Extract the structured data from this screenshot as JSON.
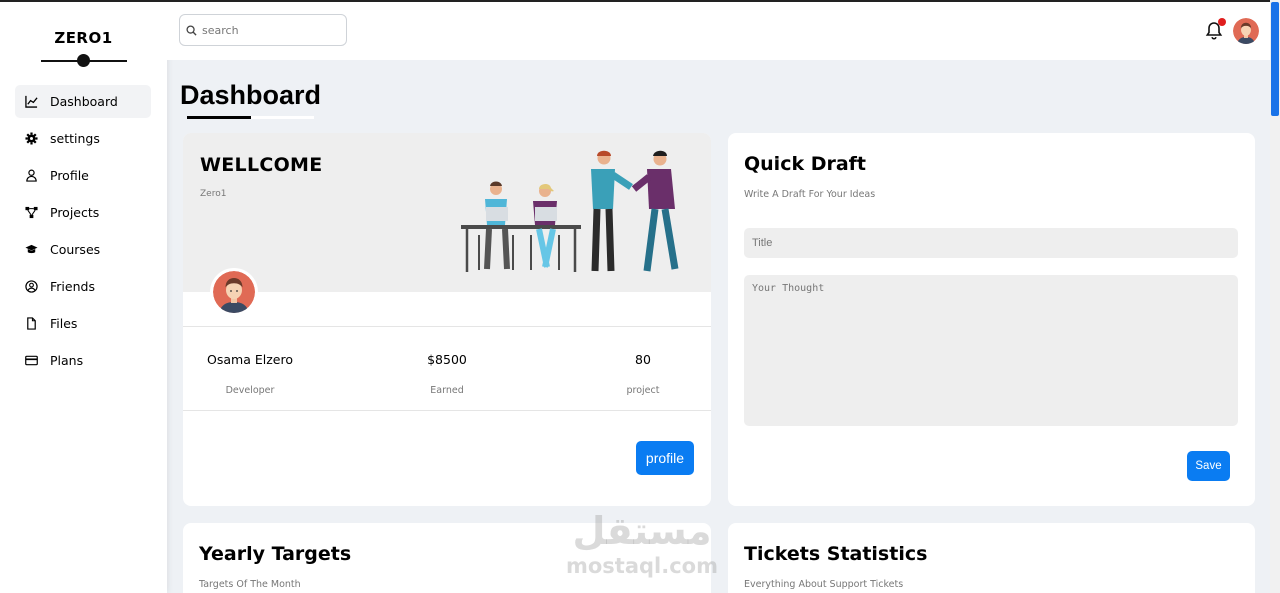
{
  "sidebar": {
    "brand": "ZERO1",
    "items": [
      {
        "label": "Dashboard",
        "icon": "chart-line-icon",
        "active": true
      },
      {
        "label": "settings",
        "icon": "gear-icon"
      },
      {
        "label": "Profile",
        "icon": "user-icon"
      },
      {
        "label": "Projects",
        "icon": "diagram-icon"
      },
      {
        "label": "Courses",
        "icon": "graduation-cap-icon"
      },
      {
        "label": "Friends",
        "icon": "user-circle-icon"
      },
      {
        "label": "Files",
        "icon": "file-icon"
      },
      {
        "label": "Plans",
        "icon": "credit-card-icon"
      }
    ]
  },
  "header": {
    "search_placeholder": "search",
    "notification_badge_color": "#e01e1e"
  },
  "page": {
    "title": "Dashboard"
  },
  "welcome": {
    "heading": "WELLCOME",
    "subheading": "Zero1",
    "stats": [
      {
        "value": "Osama Elzero",
        "label": "Developer"
      },
      {
        "value": "$8500",
        "label": "Earned"
      },
      {
        "value": "80",
        "label": "project"
      }
    ],
    "button": "profile"
  },
  "draft": {
    "heading": "Quick Draft",
    "subheading": "Write A Draft For Your Ideas",
    "title_placeholder": "Title",
    "text_placeholder": "Your Thought",
    "button": "Save"
  },
  "yearly": {
    "heading": "Yearly Targets",
    "subheading": "Targets Of The Month"
  },
  "tickets": {
    "heading": "Tickets Statistics",
    "subheading": "Everything About Support Tickets"
  },
  "watermark": {
    "arabic": "مستقل",
    "latin": "mostaql.com"
  },
  "colors": {
    "accent": "#0a7cf2",
    "background": "#eef1f5"
  }
}
